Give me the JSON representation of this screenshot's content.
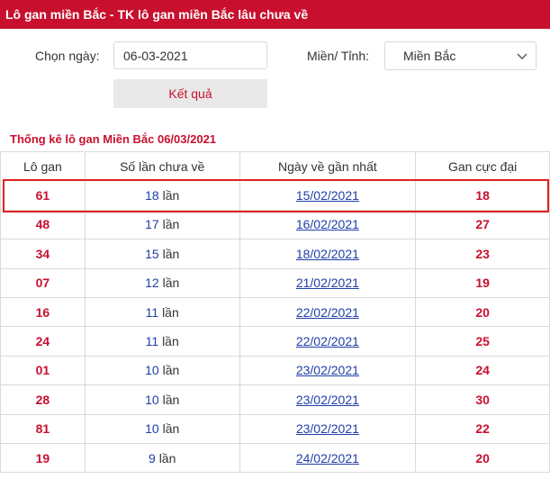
{
  "header": {
    "title": "Lô gan miền Bắc - TK lô gan miền Bắc lâu chưa về"
  },
  "form": {
    "date_label": "Chọn ngày:",
    "date_value": "06-03-2021",
    "region_label": "Miền/ Tỉnh:",
    "region_value": "Miền Bắc",
    "submit_label": "Kết quả"
  },
  "section_title": "Thống kê lô gan Miền Bắc 06/03/2021",
  "table": {
    "headers": [
      "Lô gan",
      "Số lần chưa về",
      "Ngày về gần nhất",
      "Gan cực đại"
    ],
    "unit": "lần",
    "rows": [
      {
        "number": "61",
        "count": "18",
        "last_date": "15/02/2021",
        "max": "18"
      },
      {
        "number": "48",
        "count": "17",
        "last_date": "16/02/2021",
        "max": "27"
      },
      {
        "number": "34",
        "count": "15",
        "last_date": "18/02/2021",
        "max": "23"
      },
      {
        "number": "07",
        "count": "12",
        "last_date": "21/02/2021",
        "max": "19"
      },
      {
        "number": "16",
        "count": "11",
        "last_date": "22/02/2021",
        "max": "20"
      },
      {
        "number": "24",
        "count": "11",
        "last_date": "22/02/2021",
        "max": "25"
      },
      {
        "number": "01",
        "count": "10",
        "last_date": "23/02/2021",
        "max": "24"
      },
      {
        "number": "28",
        "count": "10",
        "last_date": "23/02/2021",
        "max": "30"
      },
      {
        "number": "81",
        "count": "10",
        "last_date": "23/02/2021",
        "max": "22"
      },
      {
        "number": "19",
        "count": "9",
        "last_date": "24/02/2021",
        "max": "20"
      }
    ]
  },
  "colors": {
    "brand": "#c8102e",
    "link": "#1f3ea8",
    "highlight": "#e02020"
  },
  "icons": {
    "select_chevron": "chevron-down-icon"
  }
}
